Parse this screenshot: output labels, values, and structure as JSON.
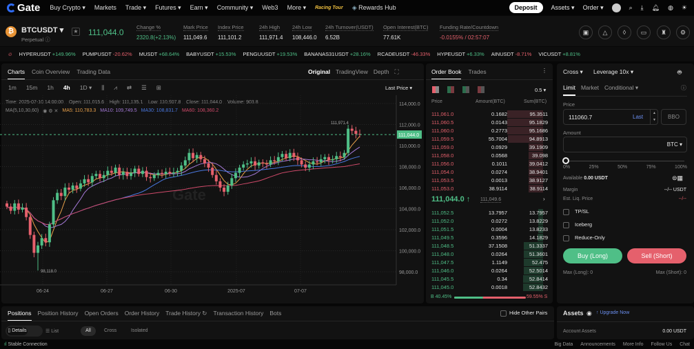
{
  "nav": {
    "logo": "Gate",
    "items": [
      "Buy Crypto ▾",
      "Markets",
      "Trade ▾",
      "Futures ▾",
      "Earn ▾",
      "Community ▾",
      "Web3",
      "More ▾"
    ],
    "promo": "Racing Tour",
    "rewards": "Rewards Hub",
    "deposit": "Deposit",
    "assets": "Assets ▾",
    "order": "Order ▾"
  },
  "ticker": {
    "symbol": "BTCUSDT",
    "type": "Perpetual",
    "price": "111,044.0",
    "stats": [
      {
        "label": "Change %",
        "value": "2320.8(+2.13%)",
        "color": "g"
      },
      {
        "label": "Mark Price",
        "value": "111,049.6"
      },
      {
        "label": "Index Price",
        "value": "111,101.2"
      },
      {
        "label": "24h High",
        "value": "111,971.4"
      },
      {
        "label": "24h Low",
        "value": "108,446.0"
      },
      {
        "label": "24h Turnover(USDT)",
        "value": "6.52B"
      },
      {
        "label": "Open Interest(BTC)",
        "value": "77.61K"
      },
      {
        "label": "Funding Rate/Countdown",
        "value": "-0.0155% / 02:57:07",
        "color": "r"
      }
    ]
  },
  "hot": [
    [
      "HYPERUSDT",
      "+149.96%"
    ],
    [
      "PUMPUSDT",
      "-20.62%"
    ],
    [
      "MUSDT",
      "+68.64%"
    ],
    [
      "BABYUSDT",
      "+15.53%"
    ],
    [
      "PENGUUSDT",
      "+19.53%"
    ],
    [
      "BANANAS31USDT",
      "+28.16%"
    ],
    [
      "RCADEUSDT",
      "-46.33%"
    ],
    [
      "HYPEUSDT",
      "+6.33%"
    ],
    [
      "AINUSDT",
      "-8.71%"
    ],
    [
      "VICUSDT",
      "+8.81%"
    ]
  ],
  "chart_tabs": [
    "Charts",
    "Coin Overview",
    "Trading Data"
  ],
  "chart_views": [
    "Original",
    "TradingView",
    "Depth"
  ],
  "intervals": [
    "1m",
    "15m",
    "1h",
    "4h",
    "1D ▾"
  ],
  "price_type": "Last Price ▾",
  "ohlc": "Time: 2025-07-10 14:00:00    Open: 111,015.6    High: 111,135.1    Low: 110,907.8    Close: 111,044.0    Volume: 903.8",
  "ma": {
    "label": "MA(5,10,30,60)",
    "ma5": "MA5: 110,783.3",
    "ma10": "MA10: 109,749.5",
    "ma30": "MA30: 108,831.7",
    "ma60": "MA60: 108,360.2"
  },
  "chart_data": {
    "type": "candlestick",
    "ylim": [
      97000,
      115000
    ],
    "yticks": [
      114000,
      112000,
      110000,
      108000,
      106000,
      104000,
      102000,
      100000,
      98000
    ],
    "ytick_labels": [
      "114,000.0",
      "112,000.0",
      "110,000.0",
      "108,000.0",
      "106,000.0",
      "104,000.0",
      "102,000.0",
      "100,000.0",
      "98,000.0"
    ],
    "xticks": [
      "06-24",
      "06-27",
      "06-30",
      "2025-07",
      "07-07"
    ],
    "last_price_label": "111,044.0",
    "high_label": "111,971.4",
    "low_label": "98,118.0",
    "watermark": "Gate",
    "closes": [
      104200,
      103800,
      104500,
      103900,
      104100,
      103200,
      101500,
      99800,
      100500,
      101200,
      100800,
      102500,
      104800,
      105500,
      105200,
      106000,
      105800,
      106200,
      105900,
      106400,
      106800,
      106500,
      107100,
      107300,
      106900,
      107200,
      107600,
      107400,
      107900,
      107200,
      107500,
      107100,
      107400,
      107800,
      107300,
      107600,
      107000,
      106900,
      107200,
      107400,
      107300,
      107500,
      107350,
      107450,
      107600,
      108100,
      108600,
      109300,
      108800,
      109100,
      108700,
      108300,
      107900,
      107200,
      106600,
      106000,
      105600,
      106200,
      106900,
      107400,
      107900,
      108200,
      108300,
      108500,
      108100,
      108400,
      108300,
      108200,
      108600,
      108500,
      108900,
      109200,
      108800,
      109300,
      108900,
      108600,
      108200,
      107900,
      108200,
      108500,
      108400,
      108700,
      108900,
      108600,
      108700,
      109000,
      108900,
      109300,
      111600,
      111400,
      111100,
      111044
    ]
  },
  "orderbook": {
    "tabs": [
      "Order Book",
      "Trades"
    ],
    "precision": "0.5 ▾",
    "headers": [
      "Price",
      "Amount(BTC)",
      "Sum(BTC)"
    ],
    "asks": [
      [
        "111,061.0",
        "0.1682",
        "95.3511"
      ],
      [
        "111,060.5",
        "0.0143",
        "95.1829"
      ],
      [
        "111,060.0",
        "0.2773",
        "95.1686"
      ],
      [
        "111,059.5",
        "55.7004",
        "94.8913"
      ],
      [
        "111,059.0",
        "0.0929",
        "39.1909"
      ],
      [
        "111,058.0",
        "0.0568",
        "39.098"
      ],
      [
        "111,056.0",
        "0.1011",
        "39.0412"
      ],
      [
        "111,054.0",
        "0.0274",
        "38.9401"
      ],
      [
        "111,053.5",
        "0.0013",
        "38.9127"
      ],
      [
        "111,053.0",
        "38.9114",
        "38.9114"
      ]
    ],
    "mid": "111,044.0 ↑",
    "mark": "111,049.6",
    "bids": [
      [
        "111,052.5",
        "13.7957",
        "13.7957"
      ],
      [
        "111,052.0",
        "0.0272",
        "13.8229"
      ],
      [
        "111,051.5",
        "0.0004",
        "13.8233"
      ],
      [
        "111,049.5",
        "0.3596",
        "14.1829"
      ],
      [
        "111,048.5",
        "37.1508",
        "51.3337"
      ],
      [
        "111,048.0",
        "0.0264",
        "51.3601"
      ],
      [
        "111,047.5",
        "1.1149",
        "52.475"
      ],
      [
        "111,046.0",
        "0.0264",
        "52.5014"
      ],
      [
        "111,045.5",
        "0.34",
        "52.8414"
      ],
      [
        "111,045.0",
        "0.0018",
        "52.8432"
      ]
    ],
    "buy_pct": "B 40.45%",
    "sell_pct": "59.55% S",
    "buy_ratio": 40.45
  },
  "trade": {
    "margin_mode": "Cross ▾",
    "leverage": "Leverage 10x ▾",
    "tabs": [
      "Limit",
      "Market",
      "Conditional ▾"
    ],
    "price_label": "Price",
    "price_value": "111060.7",
    "last": "Last",
    "bbo": "BBO",
    "amount_label": "Amount",
    "unit": "BTC ▾",
    "slider": [
      "0%",
      "25%",
      "50%",
      "75%",
      "100%"
    ],
    "slider_value": 0,
    "available_label": "Available",
    "available": "0.00 USDT",
    "margin_label": "Margin",
    "margin": "--/-- USDT",
    "liq_label": "Est. Liq. Price",
    "liq": "--/--",
    "options": [
      "TP/SL",
      "Iceberg",
      "Reduce-Only"
    ],
    "buy": "Buy (Long)",
    "sell": "Sell (Short)",
    "max_long": "Max (Long): 0",
    "max_short": "Max (Short): 0"
  },
  "assets": {
    "title": "Assets",
    "upgrade": "↑ Upgrade Now",
    "account_label": "Account Assets",
    "account_value": "0.00 USDT"
  },
  "positions": {
    "tabs": [
      "Positions",
      "Position History",
      "Open Orders",
      "Order History",
      "Trade History ↻",
      "Transaction History",
      "Bots"
    ],
    "hide": "Hide Other Pairs",
    "views": [
      "Details",
      "List"
    ],
    "filters": [
      "All",
      "Cross",
      "Isolated"
    ]
  },
  "status": {
    "connection": "Stable Connection",
    "links": [
      "Big Data",
      "Announcements",
      "More Info",
      "Follow Us",
      "Chat"
    ]
  }
}
